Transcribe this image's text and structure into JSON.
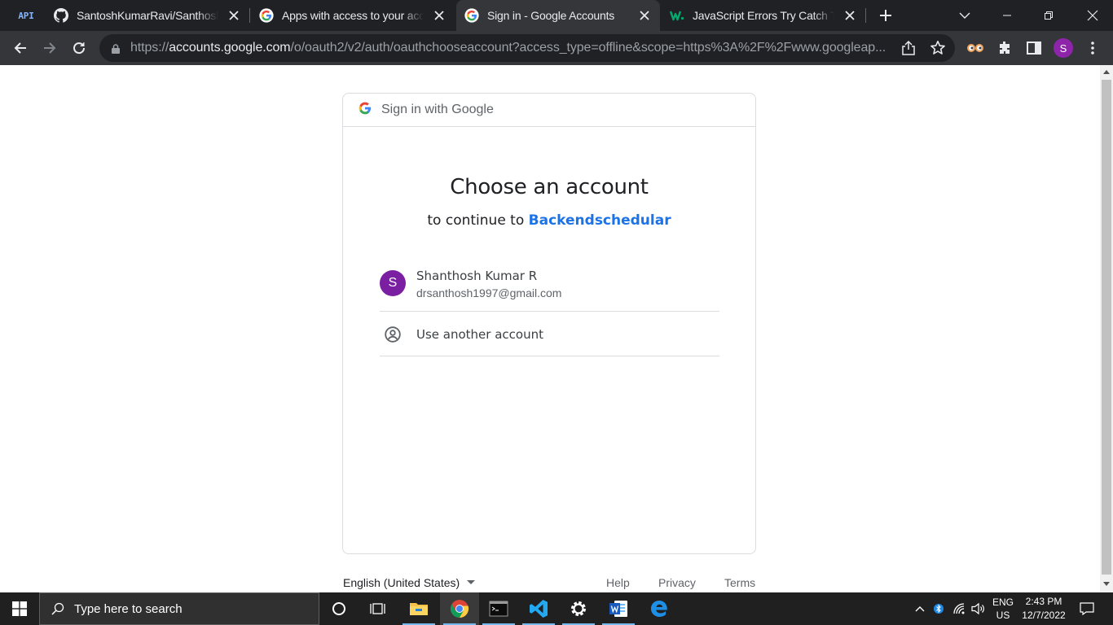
{
  "browser": {
    "tabs": [
      {
        "title": "SantoshKumarRavi/Santhoshk",
        "favicon": "github-icon",
        "active": false
      },
      {
        "title": "Apps with access to your acco",
        "favicon": "google-g-icon",
        "active": false
      },
      {
        "title": "Sign in - Google Accounts",
        "favicon": "google-g-icon",
        "active": true
      },
      {
        "title": "JavaScript Errors Try Catch Thr",
        "favicon": "w3schools-icon",
        "active": false
      }
    ],
    "pinned_tab_label": "API",
    "url_prefix": "https://",
    "url_host": "accounts.google.com",
    "url_path": "/o/oauth2/v2/auth/oauthchooseaccount?access_type=offline&scope=https%3A%2F%2Fwww.googleap...",
    "profile_initial": "S"
  },
  "signin": {
    "header_label": "Sign in with Google",
    "title": "Choose an account",
    "subtitle_prefix": "to continue to",
    "app_name": "Backendschedular",
    "account": {
      "initial": "S",
      "name": "Shanthosh Kumar R",
      "email": "drsanthosh1997@gmail.com",
      "avatar_color": "#7b1fa2"
    },
    "use_another": "Use another account"
  },
  "footer": {
    "language": "English (United States)",
    "links": [
      "Help",
      "Privacy",
      "Terms"
    ]
  },
  "taskbar": {
    "search_placeholder": "Type here to search",
    "lang_top": "ENG",
    "lang_bottom": "US",
    "time": "2:43 PM",
    "date": "12/7/2022"
  },
  "colors": {
    "accent": "#1a73e8",
    "chrome_dark": "#202124"
  }
}
